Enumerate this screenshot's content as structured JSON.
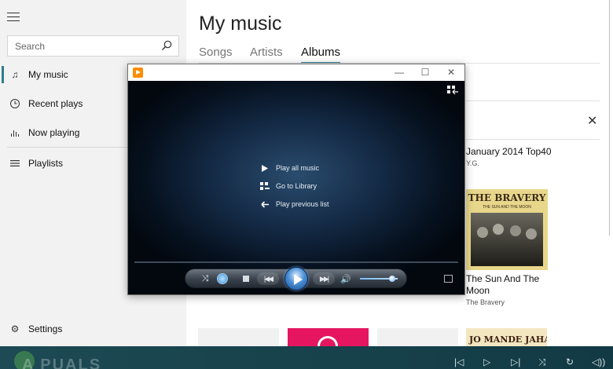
{
  "sidebar": {
    "search_placeholder": "Search",
    "items": [
      {
        "label": "My music",
        "icon": "music-note-icon",
        "active": true
      },
      {
        "label": "Recent plays",
        "icon": "clock-icon"
      },
      {
        "label": "Now playing",
        "icon": "equalizer-icon"
      },
      {
        "label": "Playlists",
        "icon": "playlist-icon"
      }
    ],
    "settings_label": "Settings"
  },
  "main": {
    "title": "My music",
    "tabs": [
      {
        "label": "Songs"
      },
      {
        "label": "Artists"
      },
      {
        "label": "Albums",
        "selected": true
      }
    ],
    "albums": [
      {
        "title": "January 2014 Top40",
        "artist": "Y.G."
      },
      {
        "title": "The Sun And The Moon",
        "artist": "The Bravery",
        "art_text": "THE BRAVERY",
        "art_subtext": "THE SUN AND THE MOON"
      }
    ],
    "bottom_thumb_text": "JO MANDE JAHARI"
  },
  "wmp": {
    "menu": [
      {
        "label": "Play all music",
        "icon": "play-triangle-icon"
      },
      {
        "label": "Go to Library",
        "icon": "library-grid-icon"
      },
      {
        "label": "Play previous list",
        "icon": "back-arrow-icon"
      }
    ],
    "volume_level": 0.85
  },
  "playerbar": {
    "watermark": "A  PUALS"
  },
  "colors": {
    "accent": "#2f7d8a",
    "sidebar_bg": "#f2f2f2",
    "player_bar": "#1d4a54",
    "wmp_logo": "#ff8c00"
  }
}
